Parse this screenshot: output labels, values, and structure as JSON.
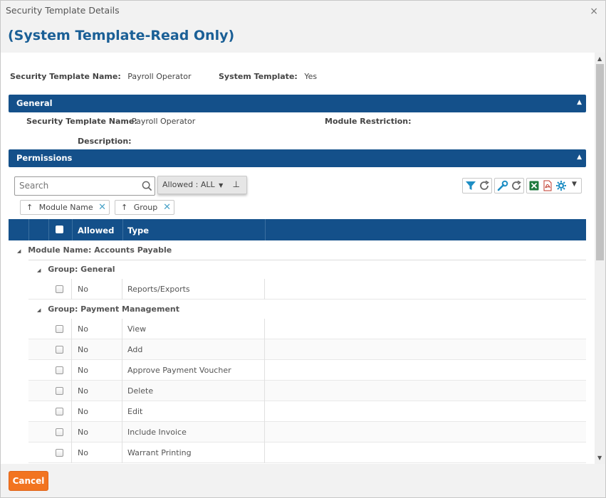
{
  "dialog": {
    "title": "Security Template Details",
    "close_label": "×",
    "heading": "(System Template-Read Only)"
  },
  "summary": {
    "name_label": "Security Template Name:",
    "name_value": "Payroll Operator",
    "system_label": "System Template:",
    "system_value": "Yes"
  },
  "general": {
    "title": "General",
    "name_label": "Security Template Name:",
    "name_value": "Payroll Operator",
    "module_restriction_label": "Module Restriction:",
    "module_restriction_value": "",
    "description_label": "Description:",
    "description_value": ""
  },
  "permissions": {
    "title": "Permissions",
    "search_placeholder": "Search",
    "filter_label": "Allowed : ALL",
    "group_chips": [
      "Module Name",
      "Group"
    ],
    "columns": [
      "Allowed",
      "Type"
    ],
    "module_group": "Module Name: Accounts Payable",
    "groups": [
      {
        "label": "Group: General",
        "rows": [
          {
            "allowed": "No",
            "type": "Reports/Exports"
          }
        ]
      },
      {
        "label": "Group: Payment Management",
        "rows": [
          {
            "allowed": "No",
            "type": "View"
          },
          {
            "allowed": "No",
            "type": "Add"
          },
          {
            "allowed": "No",
            "type": "Approve Payment Voucher"
          },
          {
            "allowed": "No",
            "type": "Delete"
          },
          {
            "allowed": "No",
            "type": "Edit"
          },
          {
            "allowed": "No",
            "type": "Include Invoice"
          },
          {
            "allowed": "No",
            "type": "Warrant Printing"
          }
        ]
      }
    ],
    "toolbar_icons": [
      "filter-icon",
      "refresh-icon",
      "wrench-icon",
      "reset-icon",
      "excel-icon",
      "pdf-icon",
      "gear-icon",
      "dropdown-caret-icon"
    ]
  },
  "footer": {
    "cancel_label": "Cancel"
  },
  "colors": {
    "header_blue": "#14508a",
    "heading_blue": "#1a5f96",
    "cancel_orange": "#f27420"
  }
}
